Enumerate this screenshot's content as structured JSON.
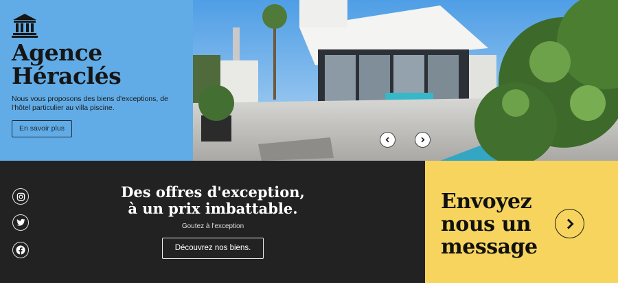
{
  "hero": {
    "brand_line1": "Agence",
    "brand_line2": "Héraclés",
    "description": "Nous vous proposons des biens d'exceptions, de l'hôtel particulier au villa piscine.",
    "cta_label": "En savoir plus"
  },
  "carousel": {
    "prev_icon": "chevron-left-icon",
    "next_icon": "chevron-right-icon"
  },
  "social": [
    "instagram-icon",
    "twitter-icon",
    "facebook-icon"
  ],
  "offers": {
    "title_line1": "Des offres d'exception,",
    "title_line2": "à un prix imbattable.",
    "subtitle": "Goutez à l'exception",
    "cta_label": "Découvrez nos biens."
  },
  "contact": {
    "line1": "Envoyez",
    "line2": "nous un",
    "line3": "message",
    "arrow_icon": "chevron-right-icon"
  },
  "colors": {
    "blue_panel": "#61ace6",
    "dark_panel": "#222222",
    "yellow_panel": "#f6d45e"
  }
}
